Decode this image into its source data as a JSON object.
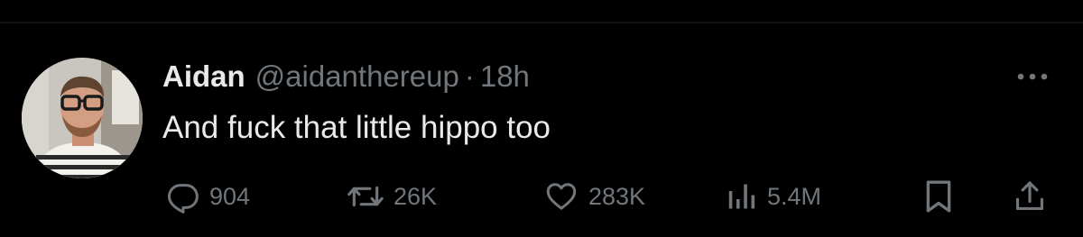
{
  "tweet": {
    "author": {
      "name": "Aidan",
      "handle": "@aidanthereup"
    },
    "separator": "·",
    "timestamp": "18h",
    "text": "And fuck that little hippo too",
    "actions": {
      "reply": {
        "icon": "reply-icon",
        "count": "904"
      },
      "retweet": {
        "icon": "retweet-icon",
        "count": "26K"
      },
      "like": {
        "icon": "heart-icon",
        "count": "283K"
      },
      "views": {
        "icon": "views-icon",
        "count": "5.4M"
      },
      "bookmark": {
        "icon": "bookmark-icon"
      },
      "share": {
        "icon": "share-icon"
      }
    },
    "more_icon": "more-icon"
  },
  "colors": {
    "background": "#000000",
    "primary_text": "#e7e9ea",
    "secondary_text": "#71767b"
  }
}
